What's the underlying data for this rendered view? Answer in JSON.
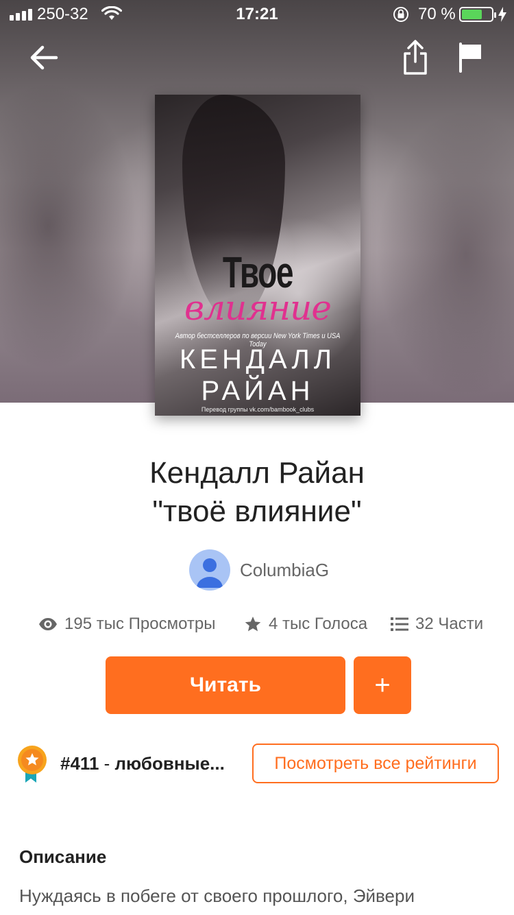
{
  "status_bar": {
    "carrier": "250-32",
    "time": "17:21",
    "battery_percent": "70 %",
    "battery_level": 0.7
  },
  "nav": {
    "back_icon": "arrow-left-icon",
    "share_icon": "share-icon",
    "flag_icon": "flag-icon"
  },
  "cover": {
    "title": "Твое",
    "subtitle": "влияние",
    "tagline": "Автор бестселлеров по версии New York Times и USA Today",
    "author_line1": "КЕНДАЛЛ",
    "author_line2": "РАЙАН",
    "credit": "Перевод группы vk.com/bambook_clubs"
  },
  "book": {
    "title_line1": "Кендалл Райан",
    "title_line2": "\"твоё влияние\"",
    "author": "ColumbiaG"
  },
  "stats": {
    "views": "195 тыс Просмотры",
    "votes": "4 тыс Голоса",
    "parts": "32 Части"
  },
  "actions": {
    "read_label": "Читать",
    "add_label": "+"
  },
  "ranking": {
    "rank": "#411",
    "separator": " - ",
    "category": "любовные...",
    "view_all_label": "Посмотреть все рейтинги"
  },
  "description": {
    "heading": "Описание",
    "text": "Нуждаясь в побеге от своего прошлого, Эйвери"
  },
  "colors": {
    "accent": "#ff6e1f",
    "avatar_bg": "#a9c4f5",
    "avatar_fg": "#3b6fe0"
  }
}
